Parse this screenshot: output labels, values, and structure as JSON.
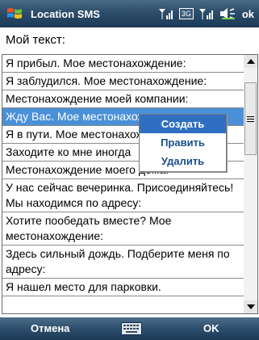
{
  "titlebar": {
    "app_title": "Location SMS",
    "ok_label": "ok",
    "network": "3G"
  },
  "heading": "Мой текст:",
  "list": {
    "items": [
      "Я прибыл. Мое местонахождение:",
      "Я заблудился. Мое местонахождение:",
      "Местонахождение моей компании:",
      "Жду Вас. Мое местонахождение:",
      "Я в пути. Мое местонахождение:",
      "Заходите ко мне иногда",
      "Местонахождение моего дома:",
      "У нас сейчас вечеринка. Присоединяйтесь! Мы находимся по адресу:",
      "Хотите пообедать вместе? Мое местонахождение:",
      "Здесь сильный дождь. Подберите меня по адресу:",
      "Я нашел место для парковки."
    ],
    "selected_index": 3
  },
  "context_menu": {
    "items": [
      "Создать",
      "Править",
      "Удалить"
    ],
    "active_index": 0
  },
  "softkeys": {
    "left": "Отмена",
    "right": "OK"
  },
  "colors": {
    "selection": "#4a90d8",
    "menu_active": "#2f6fc2",
    "bar": "#2c4d6a"
  }
}
